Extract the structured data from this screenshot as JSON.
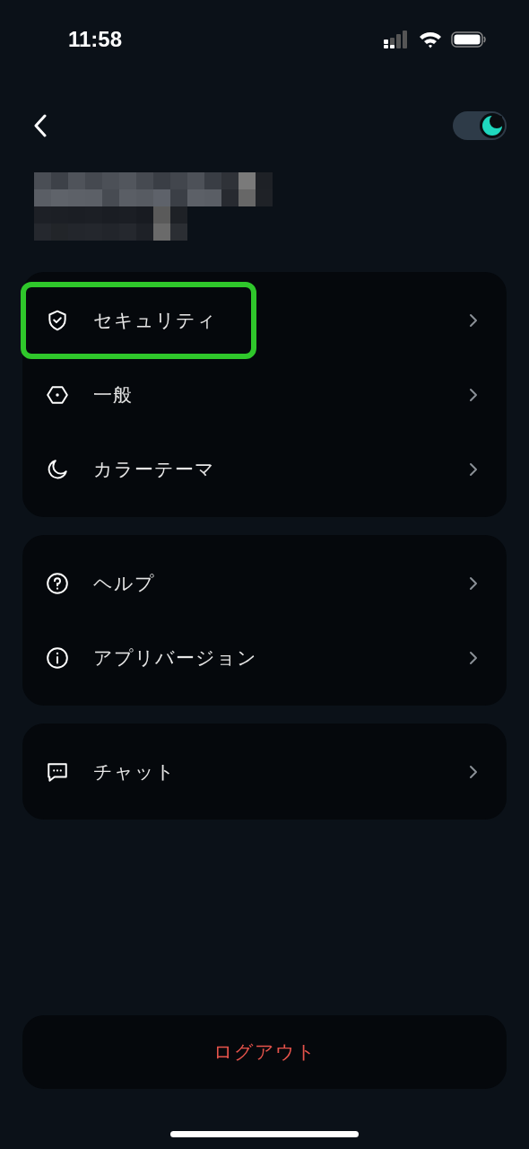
{
  "status_bar": {
    "time": "11:58"
  },
  "header": {
    "dark_mode": true
  },
  "menu_groups": [
    {
      "items": [
        {
          "kind": "shield",
          "label": "セキュリティ",
          "highlighted": true
        },
        {
          "kind": "hexagon",
          "label": "一般",
          "highlighted": false
        },
        {
          "kind": "moon",
          "label": "カラーテーマ",
          "highlighted": false
        }
      ]
    },
    {
      "items": [
        {
          "kind": "help",
          "label": "ヘルプ",
          "highlighted": false
        },
        {
          "kind": "info",
          "label": "アプリバージョン",
          "highlighted": false
        }
      ]
    },
    {
      "items": [
        {
          "kind": "chat",
          "label": "チャット",
          "highlighted": false
        }
      ]
    }
  ],
  "logout": {
    "label": "ログアウト"
  }
}
